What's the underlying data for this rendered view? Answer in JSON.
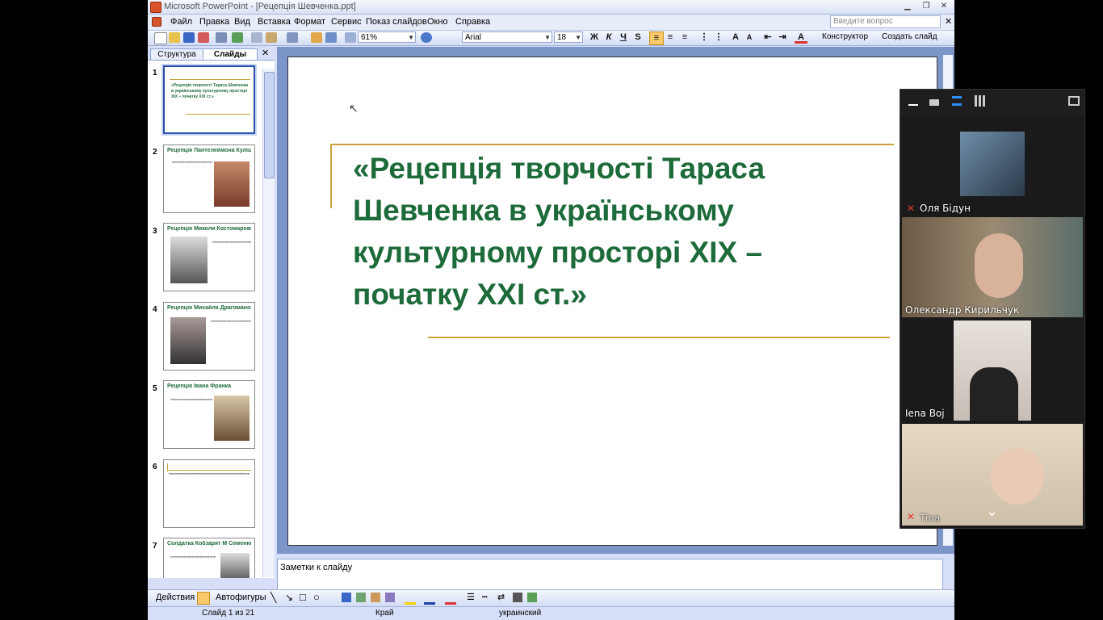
{
  "window": {
    "app_title": "Microsoft PowerPoint - [Рецепція Шевченка.ppt]"
  },
  "menu": {
    "items": [
      "Файл",
      "Правка",
      "Вид",
      "Вставка",
      "Формат",
      "Сервис",
      "Показ слайдов",
      "Окно",
      "Справка"
    ],
    "ask_placeholder": "Введите вопрос"
  },
  "toolbar": {
    "zoom": "61%",
    "font": "Arial",
    "font_size": "18",
    "bold": "Ж",
    "italic": "К",
    "underline": "Ч",
    "shadow": "S",
    "designer": "Конструктор",
    "new_slide": "Создать слайд"
  },
  "left_panel": {
    "tab_outline": "Структура",
    "tab_slides": "Слайды",
    "close": "✕"
  },
  "thumbs": [
    {
      "no": "1",
      "title": "«Рецепція творчості Тараса Шевченка в українському культурному просторі XIX – початку XXI ст.»"
    },
    {
      "no": "2",
      "title": "Рецепція Пантелеймона Куліша"
    },
    {
      "no": "3",
      "title": "Рецепція Миколи Костомарова"
    },
    {
      "no": "4",
      "title": "Рецепція Михайла Драгоманова"
    },
    {
      "no": "5",
      "title": "Рецепція Івана Франка"
    },
    {
      "no": "6",
      "title": ""
    },
    {
      "no": "7",
      "title": "Солдатка Кобзарят М Семенюк"
    }
  ],
  "slide": {
    "title": "«Рецепція творчості Тараса Шевченка в українському культурному просторі XIX – початку XXI ст.»"
  },
  "notes": {
    "placeholder": "Заметки к слайду"
  },
  "drawbar": {
    "actions": "Действия",
    "autoshapes": "Автофигуры"
  },
  "status": {
    "slide": "Слайд 1 из 21",
    "design": "Край",
    "lang": "украинский"
  },
  "zoom_panel": {
    "participants": [
      {
        "name": "Оля Бідун",
        "muted": true
      },
      {
        "name": "Олександр Кирильчук",
        "muted": false
      },
      {
        "name": "Iena Boj",
        "muted": false
      },
      {
        "name": "Tina",
        "muted": true
      }
    ],
    "chevron": "⌄"
  },
  "colors": {
    "title_green": "#1d6b3a",
    "gold_line": "#c9a33a"
  }
}
